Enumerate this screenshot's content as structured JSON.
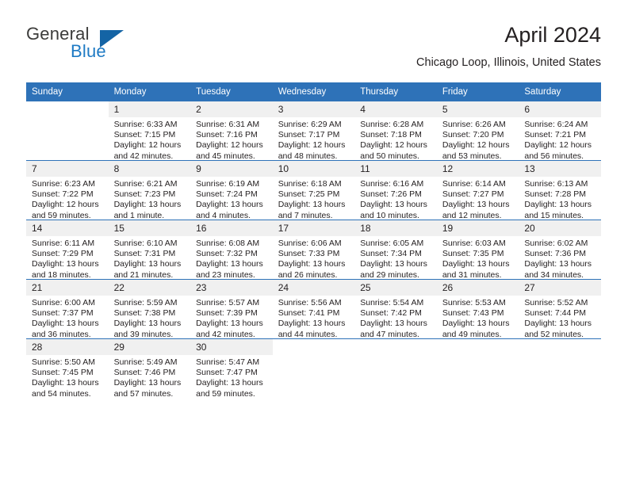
{
  "brand": {
    "name_part1": "General",
    "name_part2": "Blue",
    "logo_icon": "triangle-logo-icon",
    "color_dark": "#3c3c3b",
    "color_blue": "#1e7ac4",
    "triangle_color": "#1464a5"
  },
  "header": {
    "title": "April 2024",
    "location": "Chicago Loop, Illinois, United States"
  },
  "theme": {
    "header_blue": "#2e72b8",
    "daynum_band": "#f0f0f0",
    "text": "#231f20"
  },
  "weekday_headers": [
    "Sunday",
    "Monday",
    "Tuesday",
    "Wednesday",
    "Thursday",
    "Friday",
    "Saturday"
  ],
  "weeks": [
    [
      {
        "day": "",
        "sunrise": "",
        "sunset": "",
        "daylight_line1": "",
        "daylight_line2": ""
      },
      {
        "day": "1",
        "sunrise": "Sunrise: 6:33 AM",
        "sunset": "Sunset: 7:15 PM",
        "daylight_line1": "Daylight: 12 hours",
        "daylight_line2": "and 42 minutes."
      },
      {
        "day": "2",
        "sunrise": "Sunrise: 6:31 AM",
        "sunset": "Sunset: 7:16 PM",
        "daylight_line1": "Daylight: 12 hours",
        "daylight_line2": "and 45 minutes."
      },
      {
        "day": "3",
        "sunrise": "Sunrise: 6:29 AM",
        "sunset": "Sunset: 7:17 PM",
        "daylight_line1": "Daylight: 12 hours",
        "daylight_line2": "and 48 minutes."
      },
      {
        "day": "4",
        "sunrise": "Sunrise: 6:28 AM",
        "sunset": "Sunset: 7:18 PM",
        "daylight_line1": "Daylight: 12 hours",
        "daylight_line2": "and 50 minutes."
      },
      {
        "day": "5",
        "sunrise": "Sunrise: 6:26 AM",
        "sunset": "Sunset: 7:20 PM",
        "daylight_line1": "Daylight: 12 hours",
        "daylight_line2": "and 53 minutes."
      },
      {
        "day": "6",
        "sunrise": "Sunrise: 6:24 AM",
        "sunset": "Sunset: 7:21 PM",
        "daylight_line1": "Daylight: 12 hours",
        "daylight_line2": "and 56 minutes."
      }
    ],
    [
      {
        "day": "7",
        "sunrise": "Sunrise: 6:23 AM",
        "sunset": "Sunset: 7:22 PM",
        "daylight_line1": "Daylight: 12 hours",
        "daylight_line2": "and 59 minutes."
      },
      {
        "day": "8",
        "sunrise": "Sunrise: 6:21 AM",
        "sunset": "Sunset: 7:23 PM",
        "daylight_line1": "Daylight: 13 hours",
        "daylight_line2": "and 1 minute."
      },
      {
        "day": "9",
        "sunrise": "Sunrise: 6:19 AM",
        "sunset": "Sunset: 7:24 PM",
        "daylight_line1": "Daylight: 13 hours",
        "daylight_line2": "and 4 minutes."
      },
      {
        "day": "10",
        "sunrise": "Sunrise: 6:18 AM",
        "sunset": "Sunset: 7:25 PM",
        "daylight_line1": "Daylight: 13 hours",
        "daylight_line2": "and 7 minutes."
      },
      {
        "day": "11",
        "sunrise": "Sunrise: 6:16 AM",
        "sunset": "Sunset: 7:26 PM",
        "daylight_line1": "Daylight: 13 hours",
        "daylight_line2": "and 10 minutes."
      },
      {
        "day": "12",
        "sunrise": "Sunrise: 6:14 AM",
        "sunset": "Sunset: 7:27 PM",
        "daylight_line1": "Daylight: 13 hours",
        "daylight_line2": "and 12 minutes."
      },
      {
        "day": "13",
        "sunrise": "Sunrise: 6:13 AM",
        "sunset": "Sunset: 7:28 PM",
        "daylight_line1": "Daylight: 13 hours",
        "daylight_line2": "and 15 minutes."
      }
    ],
    [
      {
        "day": "14",
        "sunrise": "Sunrise: 6:11 AM",
        "sunset": "Sunset: 7:29 PM",
        "daylight_line1": "Daylight: 13 hours",
        "daylight_line2": "and 18 minutes."
      },
      {
        "day": "15",
        "sunrise": "Sunrise: 6:10 AM",
        "sunset": "Sunset: 7:31 PM",
        "daylight_line1": "Daylight: 13 hours",
        "daylight_line2": "and 21 minutes."
      },
      {
        "day": "16",
        "sunrise": "Sunrise: 6:08 AM",
        "sunset": "Sunset: 7:32 PM",
        "daylight_line1": "Daylight: 13 hours",
        "daylight_line2": "and 23 minutes."
      },
      {
        "day": "17",
        "sunrise": "Sunrise: 6:06 AM",
        "sunset": "Sunset: 7:33 PM",
        "daylight_line1": "Daylight: 13 hours",
        "daylight_line2": "and 26 minutes."
      },
      {
        "day": "18",
        "sunrise": "Sunrise: 6:05 AM",
        "sunset": "Sunset: 7:34 PM",
        "daylight_line1": "Daylight: 13 hours",
        "daylight_line2": "and 29 minutes."
      },
      {
        "day": "19",
        "sunrise": "Sunrise: 6:03 AM",
        "sunset": "Sunset: 7:35 PM",
        "daylight_line1": "Daylight: 13 hours",
        "daylight_line2": "and 31 minutes."
      },
      {
        "day": "20",
        "sunrise": "Sunrise: 6:02 AM",
        "sunset": "Sunset: 7:36 PM",
        "daylight_line1": "Daylight: 13 hours",
        "daylight_line2": "and 34 minutes."
      }
    ],
    [
      {
        "day": "21",
        "sunrise": "Sunrise: 6:00 AM",
        "sunset": "Sunset: 7:37 PM",
        "daylight_line1": "Daylight: 13 hours",
        "daylight_line2": "and 36 minutes."
      },
      {
        "day": "22",
        "sunrise": "Sunrise: 5:59 AM",
        "sunset": "Sunset: 7:38 PM",
        "daylight_line1": "Daylight: 13 hours",
        "daylight_line2": "and 39 minutes."
      },
      {
        "day": "23",
        "sunrise": "Sunrise: 5:57 AM",
        "sunset": "Sunset: 7:39 PM",
        "daylight_line1": "Daylight: 13 hours",
        "daylight_line2": "and 42 minutes."
      },
      {
        "day": "24",
        "sunrise": "Sunrise: 5:56 AM",
        "sunset": "Sunset: 7:41 PM",
        "daylight_line1": "Daylight: 13 hours",
        "daylight_line2": "and 44 minutes."
      },
      {
        "day": "25",
        "sunrise": "Sunrise: 5:54 AM",
        "sunset": "Sunset: 7:42 PM",
        "daylight_line1": "Daylight: 13 hours",
        "daylight_line2": "and 47 minutes."
      },
      {
        "day": "26",
        "sunrise": "Sunrise: 5:53 AM",
        "sunset": "Sunset: 7:43 PM",
        "daylight_line1": "Daylight: 13 hours",
        "daylight_line2": "and 49 minutes."
      },
      {
        "day": "27",
        "sunrise": "Sunrise: 5:52 AM",
        "sunset": "Sunset: 7:44 PM",
        "daylight_line1": "Daylight: 13 hours",
        "daylight_line2": "and 52 minutes."
      }
    ],
    [
      {
        "day": "28",
        "sunrise": "Sunrise: 5:50 AM",
        "sunset": "Sunset: 7:45 PM",
        "daylight_line1": "Daylight: 13 hours",
        "daylight_line2": "and 54 minutes."
      },
      {
        "day": "29",
        "sunrise": "Sunrise: 5:49 AM",
        "sunset": "Sunset: 7:46 PM",
        "daylight_line1": "Daylight: 13 hours",
        "daylight_line2": "and 57 minutes."
      },
      {
        "day": "30",
        "sunrise": "Sunrise: 5:47 AM",
        "sunset": "Sunset: 7:47 PM",
        "daylight_line1": "Daylight: 13 hours",
        "daylight_line2": "and 59 minutes."
      },
      {
        "day": "",
        "sunrise": "",
        "sunset": "",
        "daylight_line1": "",
        "daylight_line2": ""
      },
      {
        "day": "",
        "sunrise": "",
        "sunset": "",
        "daylight_line1": "",
        "daylight_line2": ""
      },
      {
        "day": "",
        "sunrise": "",
        "sunset": "",
        "daylight_line1": "",
        "daylight_line2": ""
      },
      {
        "day": "",
        "sunrise": "",
        "sunset": "",
        "daylight_line1": "",
        "daylight_line2": ""
      }
    ]
  ]
}
